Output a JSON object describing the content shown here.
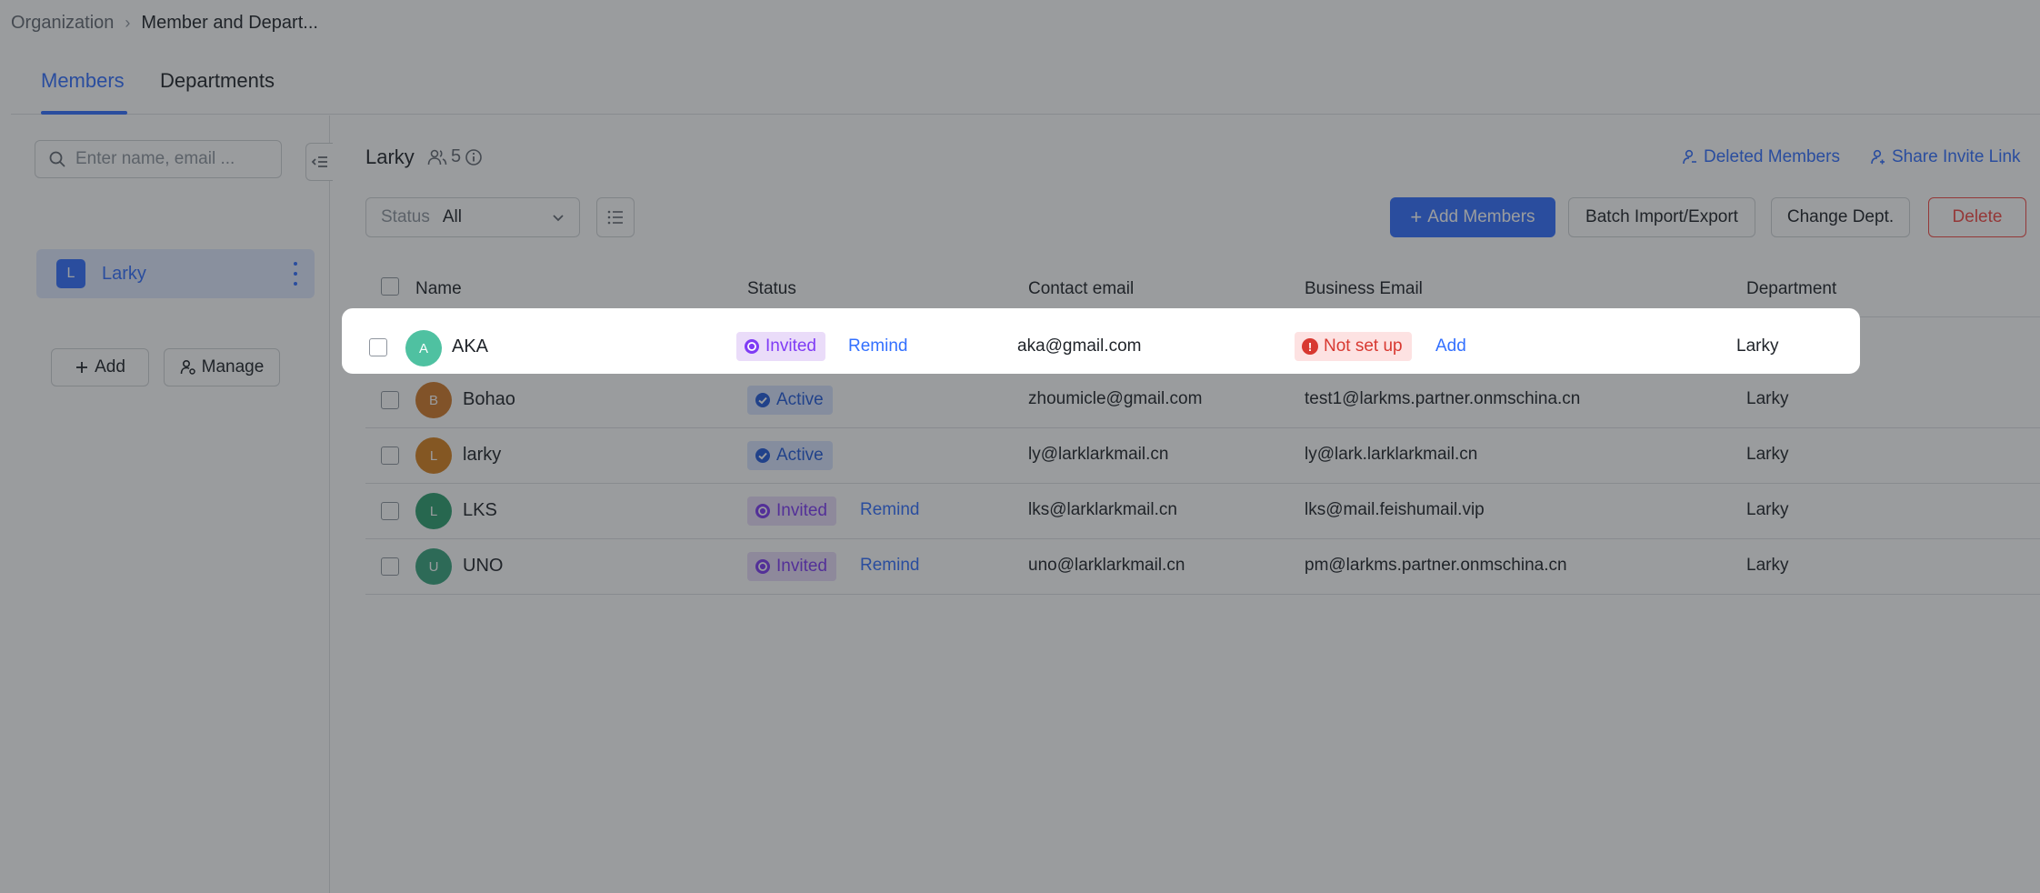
{
  "breadcrumb": {
    "root": "Organization",
    "current": "Member and Depart..."
  },
  "tabs": [
    {
      "label": "Members",
      "active": true
    },
    {
      "label": "Departments",
      "active": false
    }
  ],
  "sidebar": {
    "search_placeholder": "Enter name, email ...",
    "department": {
      "avatar_letter": "L",
      "name": "Larky"
    },
    "add_label": "Add",
    "manage_label": "Manage"
  },
  "main": {
    "department_title": "Larky",
    "member_count": "5",
    "deleted_members_label": "Deleted Members",
    "share_invite_label": "Share Invite Link",
    "filter": {
      "label": "Status",
      "value": "All"
    },
    "buttons": {
      "add_members": "Add Members",
      "batch_import": "Batch Import/Export",
      "change_dept": "Change Dept.",
      "delete": "Delete"
    }
  },
  "table": {
    "columns": [
      "Name",
      "Status",
      "Contact email",
      "Business Email",
      "Department"
    ],
    "rows": [
      {
        "initial": "A",
        "name": "AKA",
        "status": "Invited",
        "action": "Remind",
        "contact_email": "aka@gmail.com",
        "business_email": "Not set up",
        "business_action": "Add",
        "department": "Larky",
        "avatar_color": "#4fc1a1"
      },
      {
        "initial": "B",
        "name": "Bohao",
        "status": "Active",
        "action": "",
        "contact_email": "zhoumicle@gmail.com",
        "business_email": "test1@larkms.partner.onmschina.cn",
        "business_action": "",
        "department": "Larky",
        "avatar_color": "#d17a2a"
      },
      {
        "initial": "L",
        "name": "larky",
        "status": "Active",
        "action": "",
        "contact_email": "ly@larklarkmail.cn",
        "business_email": "ly@lark.larklarkmail.cn",
        "business_action": "",
        "department": "Larky",
        "avatar_color": "#d8811f"
      },
      {
        "initial": "L",
        "name": "LKS",
        "status": "Invited",
        "action": "Remind",
        "contact_email": "lks@larklarkmail.cn",
        "business_email": "lks@mail.feishumail.vip",
        "business_action": "",
        "department": "Larky",
        "avatar_color": "#2e9e6f"
      },
      {
        "initial": "U",
        "name": "UNO",
        "status": "Invited",
        "action": "Remind",
        "contact_email": "uno@larklarkmail.cn",
        "business_email": "pm@larkms.partner.onmschina.cn",
        "business_action": "",
        "department": "Larky",
        "avatar_color": "#3aa57f"
      }
    ]
  },
  "colors": {
    "accent": "#3370ff",
    "danger": "#f54a45",
    "invited_bg": "#eadcf9",
    "active_bg": "#d9e4ff",
    "not_set_bg": "#fde2e2"
  }
}
